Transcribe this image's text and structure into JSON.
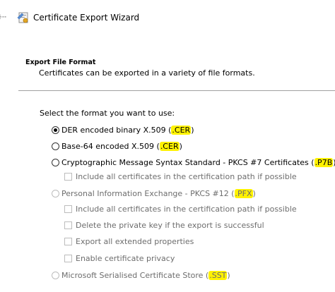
{
  "window": {
    "title": "Certificate Export Wizard",
    "back_icon": "back-arrow-icon",
    "app_icon": "certificate-wizard-icon"
  },
  "section": {
    "heading": "Export File Format",
    "description": "Certificates can be exported in a variety of file formats."
  },
  "prompt": "Select the format you want to use:",
  "formats": [
    {
      "label": "DER encoded binary X.509 (",
      "ext": ".CER",
      "close": ")",
      "selected": true,
      "enabled": true
    },
    {
      "label": "Base-64 encoded X.509 (",
      "ext": ".CER",
      "close": ")",
      "selected": false,
      "enabled": true
    },
    {
      "label": "Cryptographic Message Syntax Standard - PKCS #7 Certificates (",
      "ext": ".P7B",
      "close": ")",
      "selected": false,
      "enabled": true
    },
    {
      "label": "Personal Information Exchange - PKCS #12 (",
      "ext": ".PFX",
      "close": ")",
      "selected": false,
      "enabled": false
    },
    {
      "label": "Microsoft Serialised Certificate Store (",
      "ext": ".SST",
      "close": ")",
      "selected": false,
      "enabled": false
    }
  ],
  "options": {
    "p7b_include_path": "Include all certificates in the certification path if possible",
    "pfx_include_path": "Include all certificates in the certification path if possible",
    "pfx_delete_key": "Delete the private key if the export is successful",
    "pfx_export_props": "Export all extended properties",
    "pfx_privacy": "Enable certificate privacy"
  },
  "colors": {
    "highlight": "#fff200",
    "disabled_text": "#6d6d6d",
    "divider": "#a0a0a0"
  }
}
